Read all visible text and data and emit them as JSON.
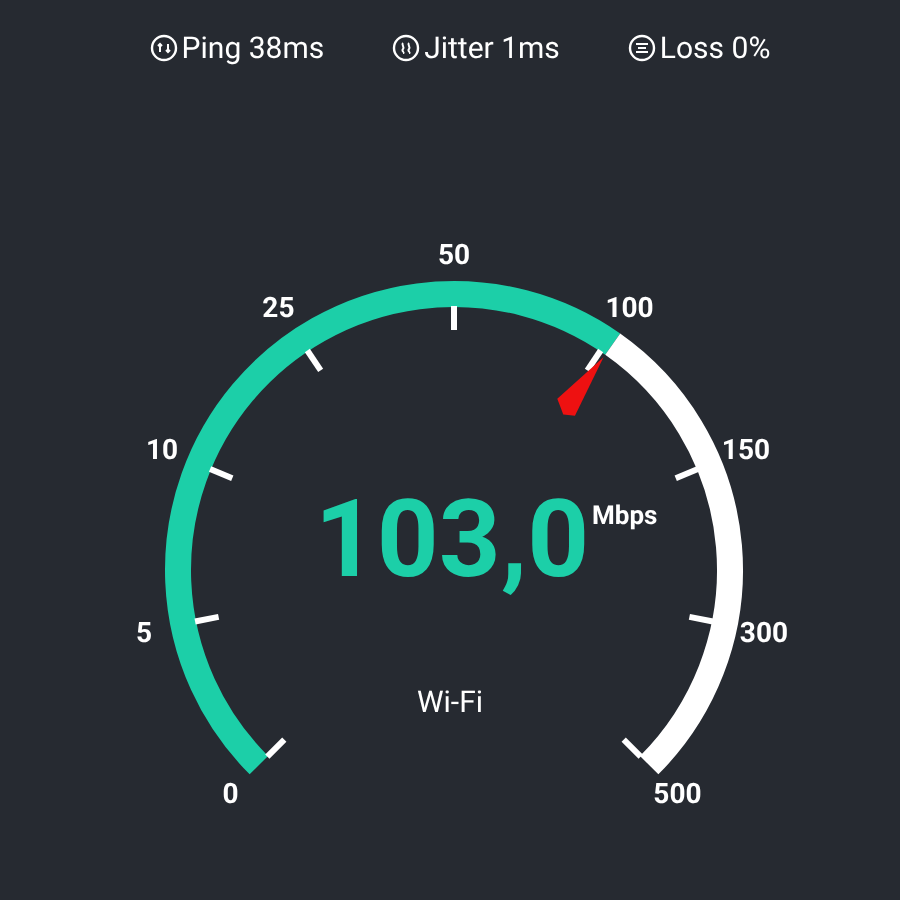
{
  "stats": [
    {
      "kind": "ping",
      "label": "Ping 38ms"
    },
    {
      "kind": "jitter",
      "label": "Jitter 1ms"
    },
    {
      "kind": "loss",
      "label": "Loss 0%"
    }
  ],
  "gauge": {
    "scale_labels": [
      "0",
      "5",
      "10",
      "25",
      "50",
      "100",
      "150",
      "300",
      "500"
    ],
    "value": "103,0",
    "unit": "Mbps",
    "connection": "Wi-Fi"
  }
}
